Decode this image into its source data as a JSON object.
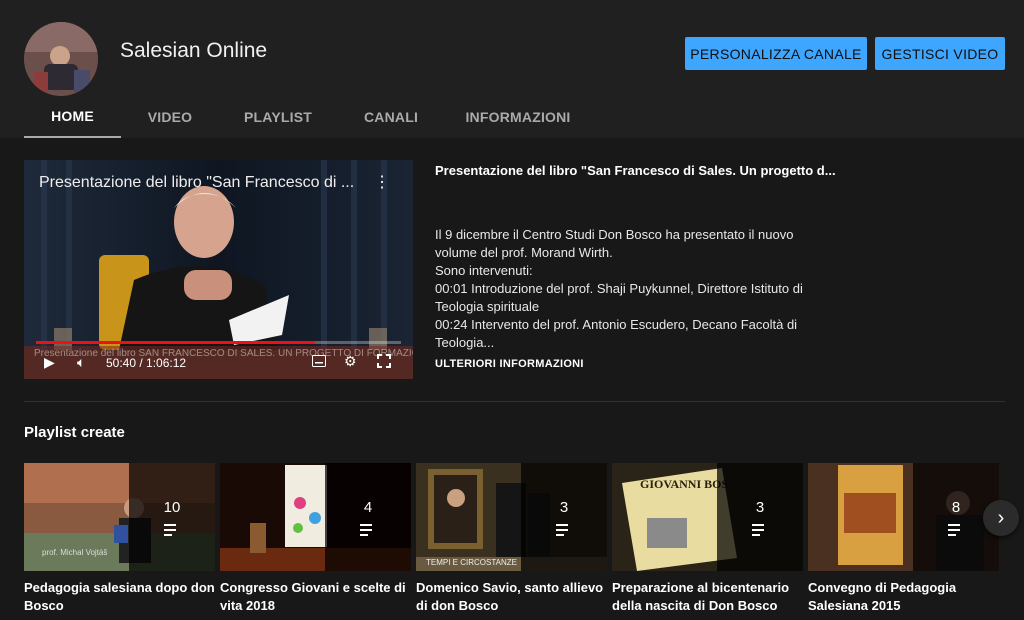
{
  "channel": {
    "name": "Salesian Online"
  },
  "buttons": {
    "customize": "PERSONALIZZA CANALE",
    "manage": "GESTISCI VIDEO"
  },
  "tabs": [
    {
      "label": "HOME",
      "active": true
    },
    {
      "label": "VIDEO"
    },
    {
      "label": "PLAYLIST"
    },
    {
      "label": "CANALI"
    },
    {
      "label": "INFORMAZIONI"
    }
  ],
  "featured": {
    "player_title": "Presentazione del libro \"San Francesco di ...",
    "banner_text": "Presentazione del libro SAN FRANCESCO DI SALES. UN PROGETTO DI FORMAZIONE INTEGRALE",
    "time": "50:40 / 1:06:12",
    "progress": 0.765,
    "title": "Presentazione del libro \"San Francesco di Sales. Un progetto d...",
    "description": [
      "Il 9 dicembre il Centro Studi Don Bosco ha presentato il nuovo volume del prof. Morand Wirth.",
      "Sono intervenuti:",
      "00:01  Introduzione del prof. Shaji Puykunnel, Direttore Istituto di Teologia spirituale",
      "00:24 Intervento del prof. Antonio Escudero, Decano Facoltà di Teologia..."
    ],
    "more": "ULTERIORI INFORMAZIONI"
  },
  "playlists_section": {
    "title": "Playlist create"
  },
  "playlists": [
    {
      "count": "10",
      "title": "Pedagogia salesiana dopo don Bosco",
      "thumb_text": "prof. Michal Vojtáš"
    },
    {
      "count": "4",
      "title": "Congresso Giovani e scelte di vita 2018",
      "thumb_text": ""
    },
    {
      "count": "3",
      "title": "Domenico Savio, santo allievo di don Bosco",
      "thumb_text": "TEMPI E CIRCOSTANZE"
    },
    {
      "count": "3",
      "title": "Preparazione al bicentenario della nascita di Don Bosco",
      "thumb_text": "GIOVANNI BOSCO"
    },
    {
      "count": "8",
      "title": "Convegno di Pedagogia Salesiana 2015",
      "thumb_text": ""
    }
  ],
  "colors": {
    "accent": "#3ea6ff",
    "background": "#181818",
    "header": "#202020"
  }
}
